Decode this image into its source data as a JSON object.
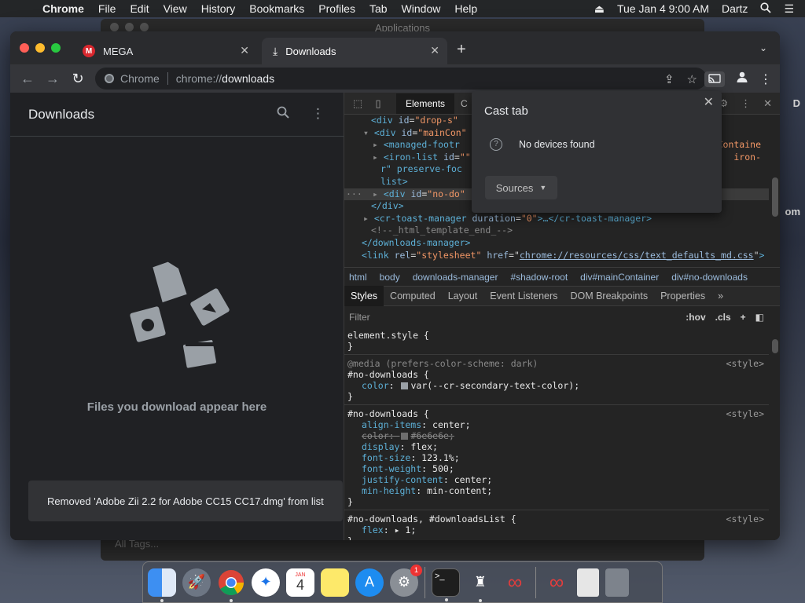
{
  "menubar": {
    "app": "Chrome",
    "items": [
      "File",
      "Edit",
      "View",
      "History",
      "Bookmarks",
      "Profiles",
      "Tab",
      "Window",
      "Help"
    ],
    "clock": "Tue Jan 4  9:00 AM",
    "user": "Dartz"
  },
  "background_window": {
    "title": "Applications",
    "sidebar_item": "All Tags..."
  },
  "desktop_edge": {
    "label1": "D",
    "label2": "om"
  },
  "chrome": {
    "tabs": [
      {
        "title": "MEGA",
        "close": "✕"
      },
      {
        "title": "Downloads",
        "close": "✕"
      }
    ],
    "newtab": "+",
    "omnibox": {
      "site_chip": "Chrome",
      "url_scheme": "chrome://",
      "url_host": "downloads"
    }
  },
  "downloads": {
    "title": "Downloads",
    "empty_message": "Files you download appear here",
    "toast": "Removed 'Adobe Zii 2.2 for Adobe CC15 CC17.dmg' from list"
  },
  "devtools": {
    "panel_tabs": [
      "Elements",
      "C"
    ],
    "elements_lines": [
      {
        "indent": 2,
        "pre": "",
        "tag": "<div",
        "attrs": [
          [
            "id",
            "drop-s"
          ]
        ],
        "post": ""
      },
      {
        "indent": 2,
        "pre": "▾",
        "tag": "<div",
        "attrs": [
          [
            "id",
            "mainCon"
          ]
        ],
        "post": ""
      },
      {
        "indent": 3,
        "pre": "▸",
        "tag": "<managed-footr",
        "attrs": [],
        "post": "",
        "right": "Containe"
      },
      {
        "indent": 3,
        "pre": "▸",
        "tag": "<iron-list",
        "attrs": [
          [
            "id",
            ""
          ]
        ],
        "post": "",
        "right": "iron-"
      },
      {
        "indent": 3,
        "pre": "",
        "tag": "",
        "attrs": [],
        "post": "r\" preserve-foc",
        "right": ""
      },
      {
        "indent": 3,
        "pre": "",
        "tag": "",
        "attrs": [],
        "post": "list>",
        "right": ""
      },
      {
        "indent": 3,
        "pre": "▸",
        "tag": "<div",
        "attrs": [
          [
            "id",
            "no-do"
          ]
        ],
        "post": "",
        "selected": true
      },
      {
        "indent": 2,
        "pre": "",
        "tag": "</div>",
        "attrs": [],
        "post": ""
      },
      {
        "indent": 2,
        "pre": "▸",
        "tag": "<cr-toast-manager",
        "attrs": [
          [
            "duration",
            "0"
          ]
        ],
        "post": ">…</cr-toast-manager>"
      },
      {
        "indent": 2,
        "pre": "",
        "tag": "",
        "attrs": [],
        "post": "",
        "comment": "<!--_html_template_end_-->"
      },
      {
        "indent": 1,
        "pre": "",
        "tag": "</downloads-manager>",
        "attrs": [],
        "post": ""
      },
      {
        "indent": 1,
        "pre": "",
        "tag": "<link",
        "attrs": [
          [
            "rel",
            "stylesheet"
          ]
        ],
        "post": "",
        "href": "chrome://resources/css/text_defaults_md.css",
        "tail": ">"
      }
    ],
    "breadcrumbs": [
      "html",
      "body",
      "downloads-manager",
      "#shadow-root",
      "div#mainContainer",
      "div#no-downloads"
    ],
    "style_tabs": [
      "Styles",
      "Computed",
      "Layout",
      "Event Listeners",
      "DOM Breakpoints",
      "Properties",
      "»"
    ],
    "filter_placeholder": "Filter",
    "filter_hov": ":hov",
    "filter_cls": ".cls",
    "rules": [
      {
        "selector": "element.style {",
        "source": "",
        "media": "",
        "props": []
      },
      {
        "selector": "#no-downloads {",
        "source": "<style>",
        "media": "@media (prefers-color-scheme: dark)",
        "props": [
          {
            "name": "color",
            "value": "var(--cr-secondary-text-color)",
            "swatch": "#9aa0a6"
          }
        ]
      },
      {
        "selector": "#no-downloads {",
        "source": "<style>",
        "media": "",
        "props": [
          {
            "name": "align-items",
            "value": "center"
          },
          {
            "name": "color",
            "value": "#6e6e6e",
            "swatch": "#6e6e6e",
            "strike": true
          },
          {
            "name": "display",
            "value": "flex"
          },
          {
            "name": "font-size",
            "value": "123.1%"
          },
          {
            "name": "font-weight",
            "value": "500"
          },
          {
            "name": "justify-content",
            "value": "center"
          },
          {
            "name": "min-height",
            "value": "min-content"
          }
        ]
      },
      {
        "selector": "#no-downloads, #downloadsList {",
        "source": "<style>",
        "media": "",
        "props": [
          {
            "name": "flex",
            "value": "▸ 1"
          }
        ]
      }
    ]
  },
  "cast_popup": {
    "title": "Cast tab",
    "message": "No devices found",
    "sources_label": "Sources"
  },
  "dock": {
    "apps": [
      "finder-icon",
      "launchpad-icon",
      "chrome-icon",
      "safari-icon",
      "calendar-icon",
      "notes-icon",
      "app-store-icon",
      "system-preferences-icon",
      "terminal-icon",
      "chess-icon",
      "creative-cloud-icon",
      "adobe-cc-icon",
      "file-icon",
      "trash-icon"
    ],
    "calendar_month": "JAN",
    "calendar_day": "4",
    "badge": "1"
  }
}
